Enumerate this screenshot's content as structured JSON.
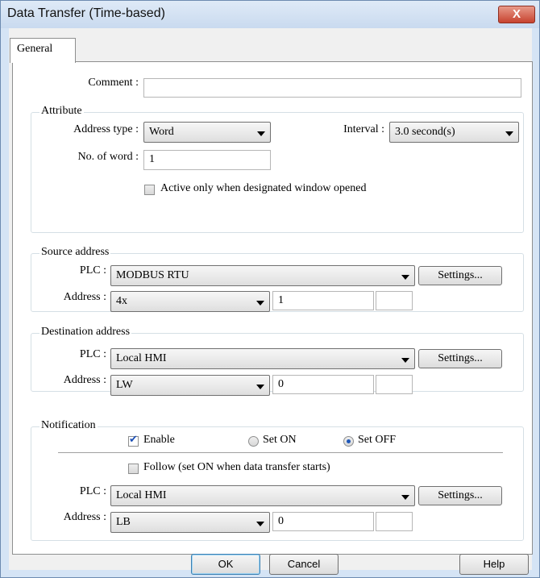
{
  "window": {
    "title": "Data Transfer (Time-based)",
    "close_label": "X"
  },
  "tabs": [
    {
      "label": "General"
    }
  ],
  "comment": {
    "label": "Comment :",
    "value": ""
  },
  "attribute": {
    "title": "Attribute",
    "address_type_label": "Address type :",
    "address_type_value": "Word",
    "interval_label": "Interval :",
    "interval_value": "3.0 second(s)",
    "no_of_word_label": "No. of word :",
    "no_of_word_value": "1",
    "active_only_label": "Active only when designated window opened",
    "active_only_checked": false
  },
  "source": {
    "title": "Source address",
    "plc_label": "PLC :",
    "plc_value": "MODBUS RTU",
    "settings_label": "Settings...",
    "address_label": "Address :",
    "address_type": "4x",
    "address_value": "1",
    "address_extra": ""
  },
  "destination": {
    "title": "Destination address",
    "plc_label": "PLC :",
    "plc_value": "Local HMI",
    "settings_label": "Settings...",
    "address_label": "Address :",
    "address_type": "LW",
    "address_value": "0",
    "address_extra": ""
  },
  "notification": {
    "title": "Notification",
    "enable_label": "Enable",
    "enable_checked": true,
    "set_on_label": "Set ON",
    "set_off_label": "Set OFF",
    "selected": "Set OFF",
    "follow_label": "Follow (set ON when data transfer starts)",
    "follow_checked": false,
    "plc_label": "PLC :",
    "plc_value": "Local HMI",
    "settings_label": "Settings...",
    "address_label": "Address :",
    "address_type": "LB",
    "address_value": "0",
    "address_extra": ""
  },
  "buttons": {
    "ok": "OK",
    "cancel": "Cancel",
    "help": "Help"
  }
}
